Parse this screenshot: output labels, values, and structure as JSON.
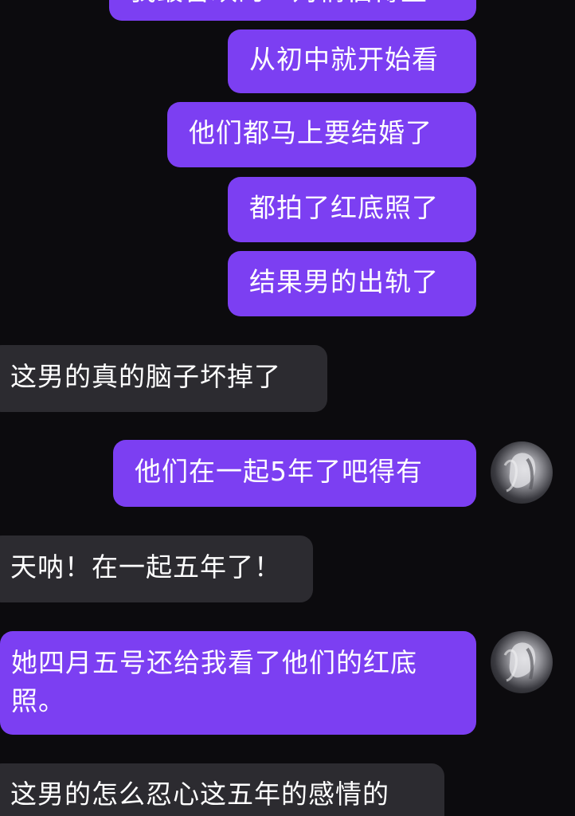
{
  "messages": [
    {
      "side": "sent",
      "text": "我最喜欢的一对情侣博主"
    },
    {
      "side": "sent",
      "text": "从初中就开始看"
    },
    {
      "side": "sent",
      "text": "他们都马上要结婚了"
    },
    {
      "side": "sent",
      "text": "都拍了红底照了"
    },
    {
      "side": "sent",
      "text": "结果男的出轨了"
    },
    {
      "side": "received",
      "text": "这男的真的脑子坏掉了"
    },
    {
      "side": "sent",
      "text": "他们在一起5年了吧得有",
      "avatar": true
    },
    {
      "side": "received",
      "text": "天呐！在一起五年了！"
    },
    {
      "side": "sent",
      "text_line1": "她四月五号还给我看了他们的红底",
      "text_line2": "照。",
      "avatar": true
    },
    {
      "side": "received",
      "text": "这男的怎么忍心这五年的感情的"
    }
  ],
  "colors": {
    "background": "#0c0b0e",
    "sent_bubble": "#7c3ff2",
    "received_bubble": "#2c2b30",
    "text": "#ffffff"
  },
  "icons": {
    "avatar": "user-avatar-icon"
  }
}
